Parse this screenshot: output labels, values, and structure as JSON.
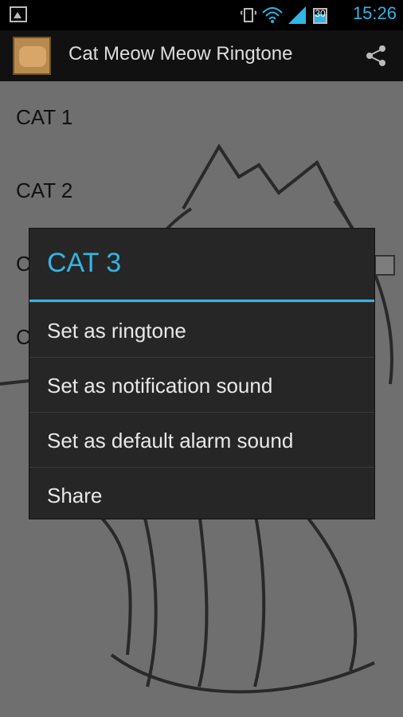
{
  "status": {
    "time": "15:26",
    "battery": "30"
  },
  "app": {
    "title": "Cat Meow Meow Ringtone"
  },
  "list": {
    "items": [
      "CAT 1",
      "CAT 2",
      "C",
      "C"
    ]
  },
  "dialog": {
    "title": "CAT 3",
    "options": [
      "Set as ringtone",
      "Set as notification sound",
      "Set as default alarm sound",
      "Share"
    ]
  },
  "colors": {
    "accent": "#33b5e5",
    "background": "#6f6f6f"
  },
  "icons": {
    "gallery": "gallery-icon",
    "wifi": "wifi-icon",
    "signal": "signal-icon",
    "battery": "battery-icon",
    "share": "share-icon"
  }
}
